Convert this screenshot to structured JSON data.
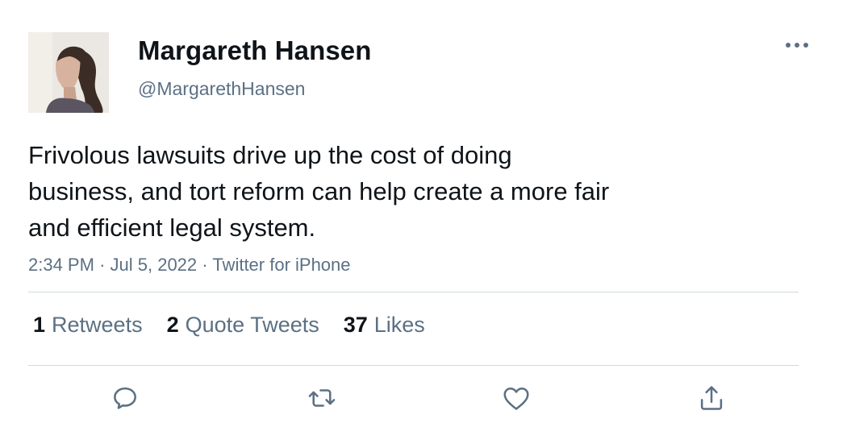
{
  "author": {
    "name": "Margareth Hansen",
    "handle": "@MargarethHansen"
  },
  "tweet": {
    "text": "Frivolous lawsuits drive up the cost of doing\nbusiness, and tort reform can help create a more fair\nand efficient legal system.",
    "time": "2:34 PM",
    "date": "Jul 5, 2022",
    "source": "Twitter for iPhone",
    "separator": "·"
  },
  "stats": {
    "retweets": {
      "count": "1",
      "label": "Retweets"
    },
    "quote_tweets": {
      "count": "2",
      "label": "Quote Tweets"
    },
    "likes": {
      "count": "37",
      "label": "Likes"
    }
  },
  "icons": {
    "more": "more-horizontal-icon",
    "reply": "reply-icon",
    "retweet": "retweet-icon",
    "like": "heart-icon",
    "share": "share-icon"
  },
  "colors": {
    "text": "#0f1419",
    "secondary": "#5b7083",
    "divider": "#cfd9de"
  }
}
